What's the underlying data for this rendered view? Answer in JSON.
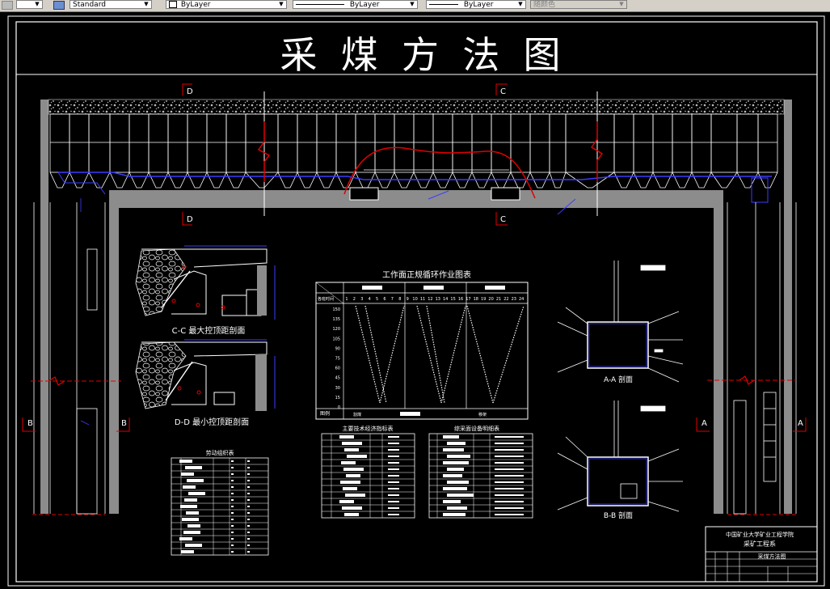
{
  "toolbar": {
    "style_value": "Standard",
    "color_value": "ByLayer",
    "linetype_value": "ByLayer",
    "lineweight_value": "ByLayer",
    "plotstyle_value": "随颜色"
  },
  "drawing": {
    "title": "采  煤  方  法  图",
    "section_marks": {
      "d": "D",
      "c": "C",
      "b": "B",
      "a": "A"
    },
    "cc_caption": "C-C 最大控顶距剖面",
    "dd_caption": "D-D 最小控顶距剖面",
    "schedule_title": "工作面正规循环作业图表",
    "schedule_row_label": "各班时间",
    "schedule_footer": "图例",
    "schedule_legend": [
      "割煤",
      "移架"
    ],
    "schedule_y_ticks": [
      "150",
      "135",
      "120",
      "105",
      "90",
      "75",
      "60",
      "45",
      "30",
      "15",
      "0"
    ],
    "schedule_hours": [
      "1",
      "2",
      "3",
      "4",
      "5",
      "6",
      "7",
      "8",
      "9",
      "10",
      "11",
      "12",
      "13",
      "14",
      "15",
      "16",
      "17",
      "18",
      "19",
      "20",
      "21",
      "22",
      "23",
      "24"
    ],
    "aa_caption": "A-A 剖面",
    "bb_caption": "B-B 剖面",
    "labour_table_title": "劳动组织表",
    "econ_table_title": "主要技术经济指标表",
    "equip_table_title": "综采面设备明细表",
    "title_block": {
      "school": "中国矿业大学矿业工程学院",
      "dept": "采矿工程系",
      "drawing_name": "采煤方法图"
    }
  },
  "colors": {
    "background": "#000000",
    "lines": "#ffffff",
    "accent_blue": "#3c3cff",
    "accent_red": "#e00000",
    "wall_gray": "#8c8c8c"
  }
}
